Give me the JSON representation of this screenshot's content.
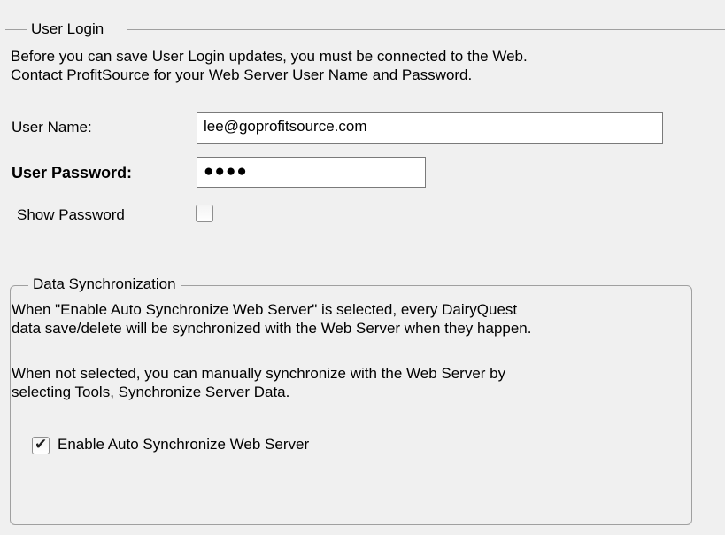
{
  "user_login": {
    "legend": "User Login",
    "description_line1": "Before you can save User Login updates, you must be connected to the Web.",
    "description_line2": "Contact ProfitSource for your Web Server User Name and Password.",
    "username_label": "User Name:",
    "username_value": "lee@goprofitsource.com",
    "password_label": "User Password:",
    "password_value": "●●●●",
    "show_password_label": "Show Password",
    "show_password_checked": false
  },
  "data_sync": {
    "legend": "Data Synchronization",
    "paragraph1_line1": "When \"Enable Auto Synchronize Web Server\" is selected, every DairyQuest",
    "paragraph1_line2": "data save/delete will be synchronized with the Web Server when they happen.",
    "paragraph2_line1": "When not selected, you can manually synchronize with the Web Server by",
    "paragraph2_line2": "selecting Tools, Synchronize Server Data.",
    "auto_sync_label": "Enable Auto Synchronize Web Server",
    "auto_sync_checked": true,
    "check_glyph": "✔"
  }
}
